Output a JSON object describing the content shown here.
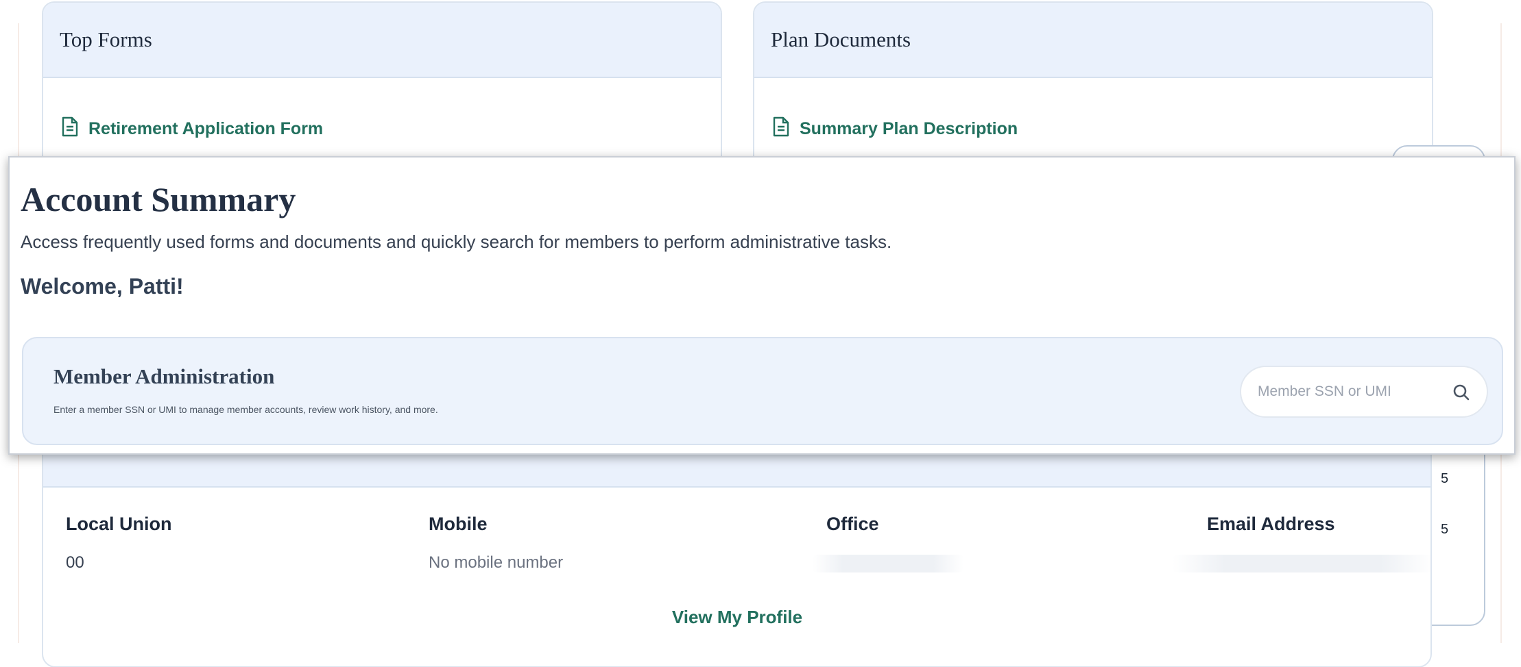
{
  "top_forms": {
    "title": "Top Forms",
    "links": [
      {
        "label": "Retirement Application Form",
        "icon": "document-icon"
      }
    ]
  },
  "plan_documents": {
    "title": "Plan Documents",
    "links": [
      {
        "label": "Summary Plan Description",
        "icon": "document-icon"
      }
    ]
  },
  "right_partial": {
    "values": [
      "5",
      "5"
    ]
  },
  "account_summary": {
    "title": "Account Summary",
    "subtitle": "Access frequently used forms and documents and quickly search for members to perform administrative tasks.",
    "welcome": "Welcome, Patti!"
  },
  "member_admin": {
    "title": "Member Administration",
    "description": "Enter a member SSN or UMI to manage member accounts, review work history, and more.",
    "search_placeholder": "Member SSN or UMI",
    "search_icon": "search-icon"
  },
  "profile": {
    "columns": [
      {
        "label": "Local Union",
        "value": "00"
      },
      {
        "label": "Mobile",
        "value": "No mobile number"
      },
      {
        "label": "Office",
        "value": ""
      },
      {
        "label": "Email Address",
        "value": ""
      }
    ],
    "view_profile_label": "View My Profile"
  },
  "colors": {
    "accent_green": "#22705e",
    "header_band": "#eaf1fc",
    "title_text": "#1e293b"
  }
}
